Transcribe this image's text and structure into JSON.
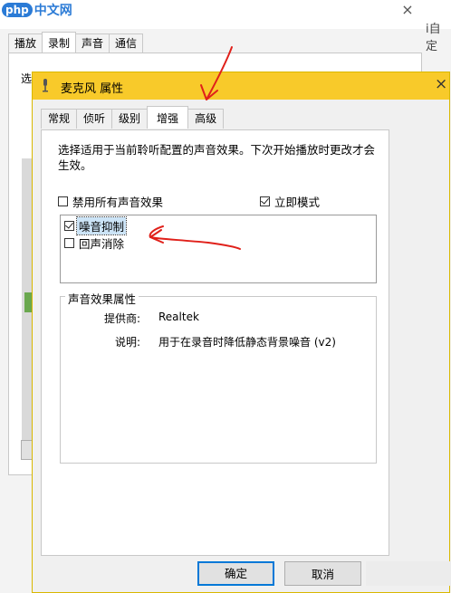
{
  "watermark": {
    "badge": "php",
    "site": "中文网"
  },
  "background_window": {
    "right_text": "i自定",
    "close_glyph": "×",
    "tabs": [
      "播放",
      "录制",
      "声音",
      "通信"
    ],
    "active_tab": 1,
    "panel_label": "选"
  },
  "dialog": {
    "title": "麦克风 属性",
    "close_glyph": "×",
    "tabs": [
      "常规",
      "侦听",
      "级别",
      "增强",
      "高级"
    ],
    "active_tab": 3,
    "description": "选择适用于当前聆听配置的声音效果。下次开始播放时更改才会生效。",
    "disable_all_label": "禁用所有声音效果",
    "disable_all_checked": false,
    "immediate_mode_label": "立即模式",
    "immediate_mode_checked": true,
    "effects": [
      {
        "label": "噪音抑制",
        "checked": true,
        "selected": true
      },
      {
        "label": "回声消除",
        "checked": false,
        "selected": false
      }
    ],
    "properties": {
      "legend": "声音效果属性",
      "provider_label": "提供商:",
      "provider_value": "Realtek",
      "description_label": "说明:",
      "description_value": "用于在录音时降低静态背景噪音 (v2)"
    },
    "ok_label": "确定",
    "cancel_label": "取消"
  },
  "colors": {
    "titlebar": "#f8ca2a",
    "annotation": "#e0201a",
    "focus": "#0078d7"
  }
}
